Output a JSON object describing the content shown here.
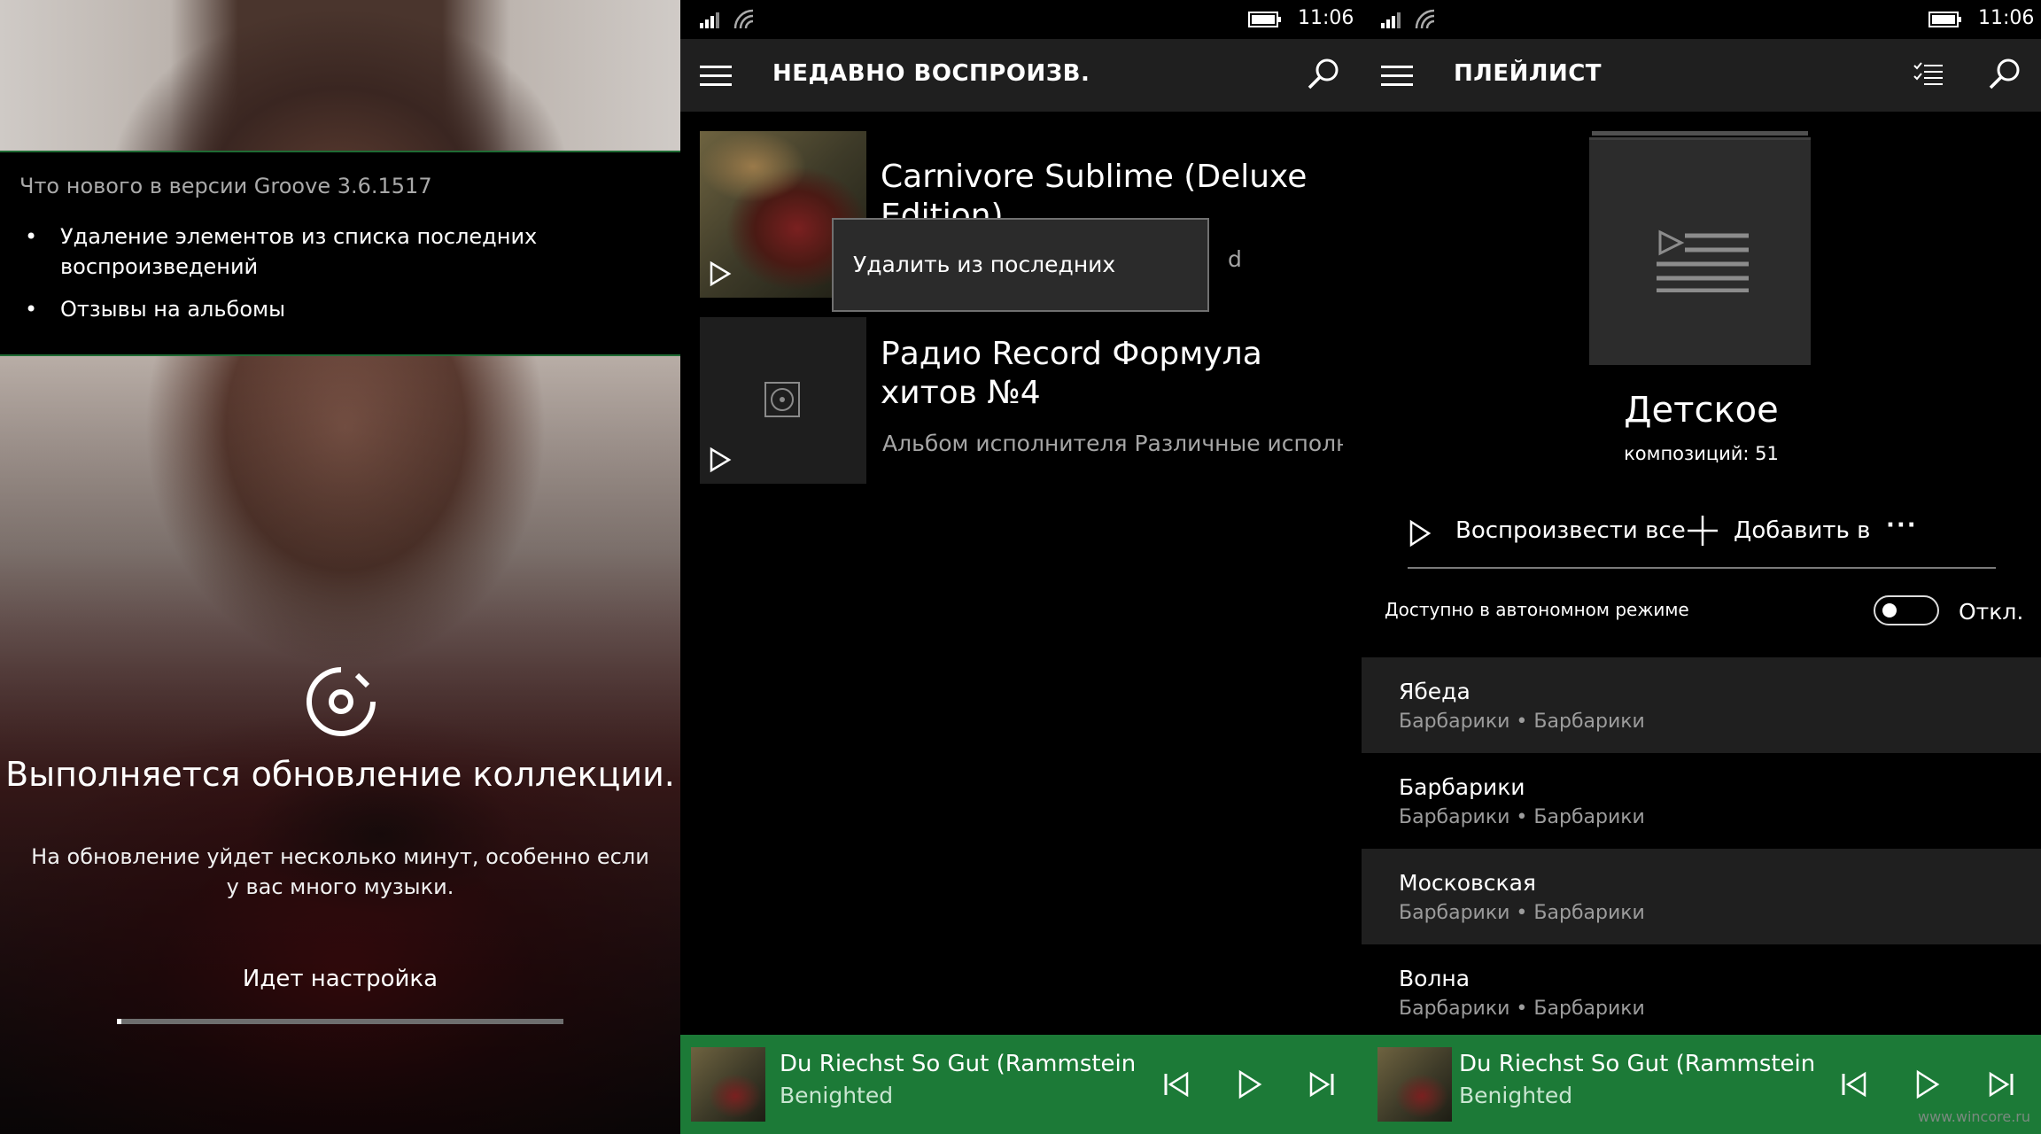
{
  "colors": {
    "accent": "#1c7a37",
    "background": "#000000",
    "surface": "#1f1f1f",
    "progress": "#ffffff"
  },
  "panel1": {
    "whats_new_title": "Что нового в версии Groove 3.6.1517",
    "bullets": [
      "Удаление элементов из списка последних воспроизведений",
      "Отзывы на альбомы"
    ],
    "bullet_glyph": "•",
    "update_title": "Выполняется обновление коллекции.",
    "update_desc": "На обновление уйдет несколько минут, особенно если у вас много музыки.",
    "setup_label": "Идет настройка",
    "progress": 0.01
  },
  "status": {
    "time": "11:06"
  },
  "panel2": {
    "title": "НЕДАВНО ВОСПРОИЗВ.",
    "albums": [
      {
        "title": "Carnivore Sublime (Deluxe Edition)",
        "subtitle": "d"
      },
      {
        "title": "Радио Record Формула хитов №4",
        "subtitle": "Альбом исполнителя Различные исполнители"
      }
    ],
    "context_menu_item": "Удалить из последних"
  },
  "now_playing": {
    "title": "Du Riechst So Gut (Rammstein cover)",
    "artist": "Benighted"
  },
  "panel3": {
    "title": "ПЛЕЙЛИСТ",
    "playlist_name": "Детское",
    "track_count": "композиций: 51",
    "play_all": "Воспроизвести все",
    "add_to": "Добавить в",
    "more": "···",
    "offline_label": "Доступно в автономном режиме",
    "offline_state": "Откл.",
    "tracks": [
      {
        "title": "Ябеда",
        "subtitle": "Барбарики • Барбарики"
      },
      {
        "title": "Барбарики",
        "subtitle": "Барбарики • Барбарики"
      },
      {
        "title": "Московская",
        "subtitle": "Барбарики • Барбарики"
      },
      {
        "title": "Волна",
        "subtitle": "Барбарики • Барбарики"
      }
    ]
  },
  "watermark": "www.wincore.ru",
  "icons": [
    "hamburger-icon",
    "search-icon",
    "select-list-icon",
    "play-icon",
    "plus-icon",
    "previous-icon",
    "next-icon",
    "groove-music-icon",
    "disc-icon",
    "playlist-icon",
    "signal-icon",
    "wifi-icon",
    "battery-icon"
  ]
}
